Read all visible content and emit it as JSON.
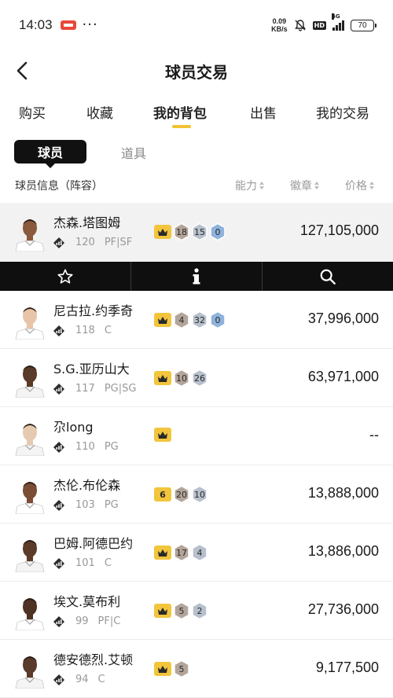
{
  "status": {
    "time": "14:03",
    "speed_value": "0.09",
    "speed_unit": "KB/s",
    "hd": "HD",
    "network": "4G",
    "battery": "70"
  },
  "nav": {
    "title": "球员交易"
  },
  "tabs": [
    "购买",
    "收藏",
    "我的背包",
    "出售",
    "我的交易"
  ],
  "active_tab": "我的背包",
  "subtabs": {
    "active": "球员",
    "other": "道具"
  },
  "columns": {
    "info": "球员信息（阵容）",
    "ability": "能力",
    "badge": "徽章",
    "price": "价格"
  },
  "colors": {
    "accent": "#f1c232",
    "crown": "#f2c53d",
    "hex_bronze": "#b3a59a",
    "hex_silver": "#b7c0cc",
    "hex_blue": "#8fb3dd"
  },
  "players": [
    {
      "name": "杰森.塔图姆",
      "ovr": "120",
      "pos": "PF|SF",
      "crown": "",
      "hexes": [
        {
          "v": "18",
          "c": "bronze"
        },
        {
          "v": "15",
          "c": "silver"
        },
        {
          "v": "0",
          "c": "blue"
        }
      ],
      "price": "127,105,000",
      "skin": "#8a5a3c",
      "jersey": "#ffffff"
    },
    {
      "name": "尼古拉.约季奇",
      "ovr": "118",
      "pos": "C",
      "crown": "",
      "hexes": [
        {
          "v": "4",
          "c": "bronze"
        },
        {
          "v": "32",
          "c": "silver"
        },
        {
          "v": "0",
          "c": "blue"
        }
      ],
      "price": "37,996,000",
      "skin": "#e8c4a8",
      "jersey": "#ffffff"
    },
    {
      "name": "S.G.亚历山大",
      "ovr": "117",
      "pos": "PG|SG",
      "crown": "",
      "hexes": [
        {
          "v": "10",
          "c": "bronze"
        },
        {
          "v": "26",
          "c": "silver"
        }
      ],
      "price": "63,971,000",
      "skin": "#5a3a28",
      "jersey": "#f4f4f4"
    },
    {
      "name": "尕long",
      "ovr": "110",
      "pos": "PG",
      "crown": "",
      "hexes": [],
      "price": "--",
      "skin": "#e5c9b0",
      "jersey": "#f4f4f4"
    },
    {
      "name": "杰伦.布伦森",
      "ovr": "103",
      "pos": "PG",
      "crown": "6",
      "hexes": [
        {
          "v": "20",
          "c": "bronze"
        },
        {
          "v": "10",
          "c": "silver"
        }
      ],
      "price": "13,888,000",
      "skin": "#7a4e34",
      "jersey": "#ffffff"
    },
    {
      "name": "巴姆.阿德巴约",
      "ovr": "101",
      "pos": "C",
      "crown": "",
      "hexes": [
        {
          "v": "17",
          "c": "bronze"
        },
        {
          "v": "4",
          "c": "silver"
        }
      ],
      "price": "13,886,000",
      "skin": "#5d3b29",
      "jersey": "#f4f4f4"
    },
    {
      "name": "埃文.莫布利",
      "ovr": "99",
      "pos": "PF|C",
      "crown": "",
      "hexes": [
        {
          "v": "5",
          "c": "bronze"
        },
        {
          "v": "2",
          "c": "silver"
        }
      ],
      "price": "27,736,000",
      "skin": "#4e3224",
      "jersey": "#ffffff"
    },
    {
      "name": "德安德烈.艾顿",
      "ovr": "94",
      "pos": "C",
      "crown": "",
      "hexes": [
        {
          "v": "5",
          "c": "bronze"
        }
      ],
      "price": "9,177,500",
      "skin": "#5a3a2a",
      "jersey": "#f4f4f4"
    }
  ],
  "actions": [
    {
      "name": "favorite-star-icon"
    },
    {
      "name": "info-icon"
    },
    {
      "name": "search-icon"
    }
  ]
}
